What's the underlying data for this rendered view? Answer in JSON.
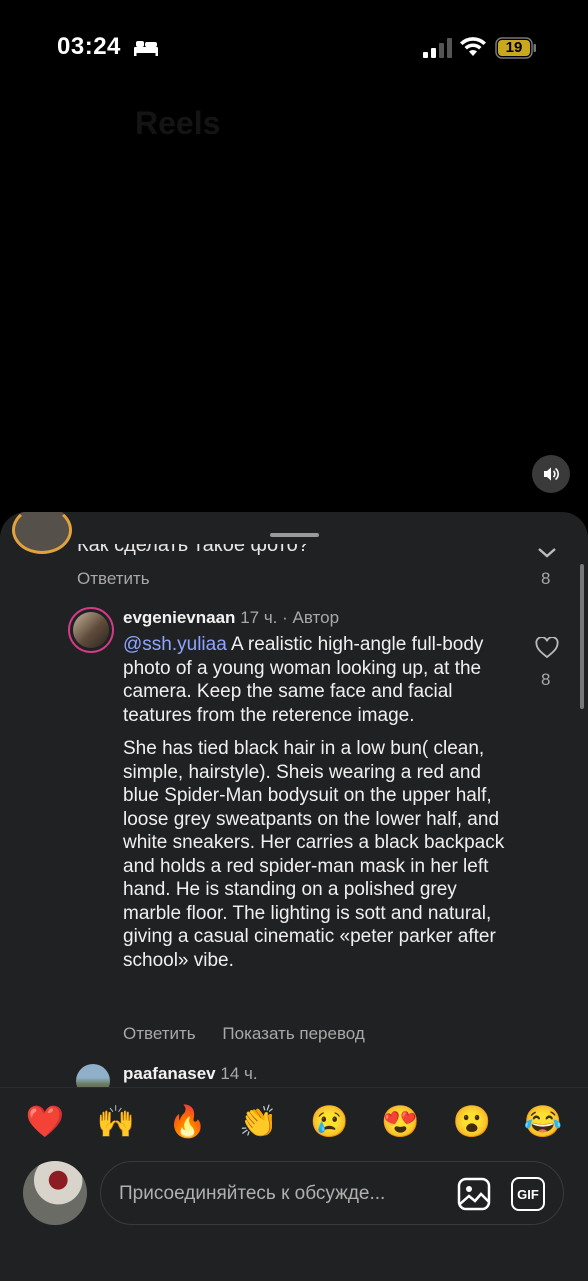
{
  "status_bar": {
    "time": "03:24",
    "battery": "19"
  },
  "background_title": "Reels",
  "previous_comment": {
    "text": "Как сделать такое фото?",
    "reply_label": "Ответить",
    "like_count": "8"
  },
  "comment": {
    "username": "evgenievnaan",
    "time": "17 ч.",
    "author_badge": "· Автор",
    "mention": "@ssh.yuliaa",
    "text_1": "A realistic high-angle full-body photo of a young woman looking up, at the camera. Keep the same face and facial teatures from the reterence image.",
    "text_2": "She has tied black hair in a low bun( clean, simple, hairstyle). Sheis wearing a red and blue Spider-Man bodysuit on the upper half, loose grey sweatpants on the lower half, and white sneakers. Her carries a black backpack and holds a red spider-man mask in her left hand. He is standing on a polished grey marble floor. The lighting is sott and natural, giving a casual cinematic «peter parker after school» vibe.",
    "like_count": "8",
    "reply_label": "Ответить",
    "translate_label": "Показать перевод"
  },
  "next_comment": {
    "username": "paafanasev",
    "time": "14 ч."
  },
  "reactions": [
    "❤️",
    "🙌",
    "🔥",
    "👏",
    "😢",
    "😍",
    "😮",
    "😂"
  ],
  "composer": {
    "placeholder": "Присоединяйтесь к обсужде...",
    "gif_label": "GIF"
  },
  "colors": {
    "mention": "#8fa4ff",
    "sheet_bg": "#202123",
    "secondary_text": "#a8a8a8"
  }
}
